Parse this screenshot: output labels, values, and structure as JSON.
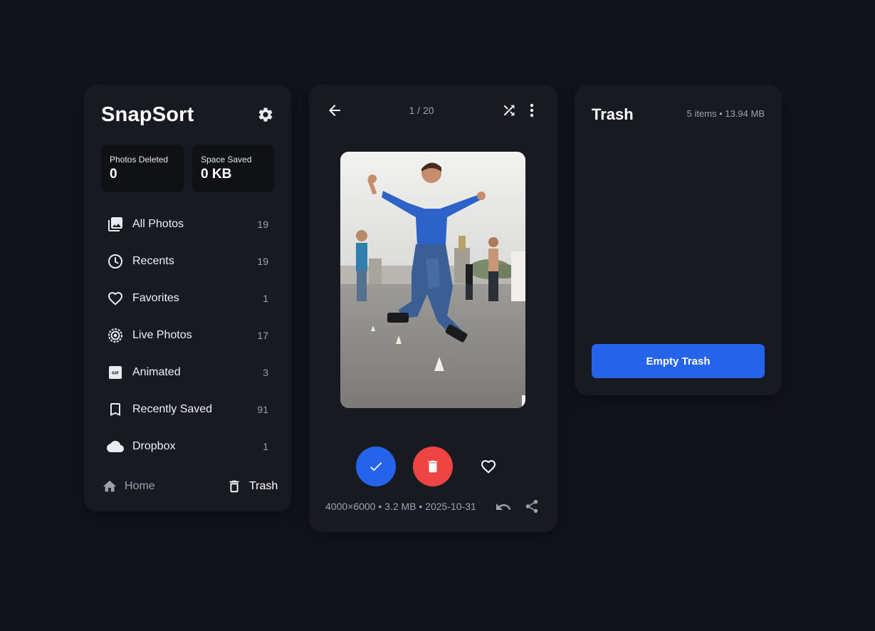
{
  "app": {
    "title": "SnapSort"
  },
  "stats": {
    "deleted": {
      "label": "Photos Deleted",
      "value": "0"
    },
    "saved": {
      "label": "Space Saved",
      "value": "0 KB"
    }
  },
  "nav": [
    {
      "label": "All Photos",
      "count": "19",
      "icon": "photo-library-icon"
    },
    {
      "label": "Recents",
      "count": "19",
      "icon": "clock-icon"
    },
    {
      "label": "Favorites",
      "count": "1",
      "icon": "heart-icon"
    },
    {
      "label": "Live Photos",
      "count": "17",
      "icon": "live-photo-icon"
    },
    {
      "label": "Animated",
      "count": "3",
      "icon": "gif-icon"
    },
    {
      "label": "Recently Saved",
      "count": "91",
      "icon": "bookmark-icon"
    },
    {
      "label": "Dropbox",
      "count": "1",
      "icon": "cloud-icon"
    }
  ],
  "footer": {
    "home_label": "Home",
    "trash_label": "Trash"
  },
  "viewer": {
    "counter": "1 / 20",
    "meta": "4000×6000 • 3.2 MB • 2025-10-31"
  },
  "trash": {
    "title": "Trash",
    "info": "5 items • 13.94 MB",
    "empty_button": "Empty Trash"
  },
  "colors": {
    "background": "#11141a",
    "panel": "#171a21",
    "accent_blue": "#2563eb",
    "delete_red": "#ef4444"
  }
}
